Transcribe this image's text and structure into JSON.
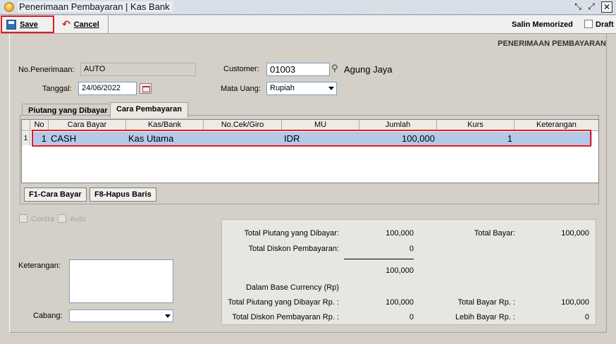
{
  "window": {
    "title": "Penerimaan Pembayaran | Kas Bank",
    "icon": "app-logo-icon"
  },
  "toolbar": {
    "save_label": "Save",
    "cancel_label": "Cancel",
    "salin_label": "Salin Memorized",
    "draft_label": "Draft"
  },
  "header": {
    "section_title": "PENERIMAAN PEMBAYARAN"
  },
  "form": {
    "no_penerimaan_label": "No.Penerimaan:",
    "no_penerimaan_value": "AUTO",
    "tanggal_label": "Tanggal:",
    "tanggal_value": "24/06/2022",
    "customer_label": "Customer:",
    "customer_code": "01003",
    "customer_name": "Agung Jaya",
    "mata_uang_label": "Mata Uang:",
    "mata_uang_value": "Rupiah"
  },
  "tabs": [
    {
      "label": "Piutang yang Dibayar",
      "active": false
    },
    {
      "label": "Cara Pembayaran",
      "active": true
    }
  ],
  "grid": {
    "columns": [
      "No",
      "Cara Bayar",
      "Kas/Bank",
      "No.Cek/Giro",
      "MU",
      "Jumlah",
      "Kurs",
      "Keterangan"
    ],
    "rows": [
      {
        "marker": "1",
        "no": "1",
        "cara_bayar": "CASH",
        "kas_bank": "Kas Utama",
        "no_cek": "",
        "mu": "IDR",
        "jumlah": "100,000",
        "kurs": "1",
        "keterangan": ""
      }
    ]
  },
  "grid_buttons": {
    "cara_bayar": "F1-Cara Bayar",
    "hapus_baris": "F8-Hapus Baris"
  },
  "options": {
    "contra_label": "Contra",
    "auto_label": "Auto"
  },
  "bottom": {
    "keterangan_label": "Keterangan:",
    "cabang_label": "Cabang:"
  },
  "summary": {
    "total_piutang_label": "Total Piutang yang Dibayar:",
    "total_piutang_value": "100,000",
    "total_diskon_label": "Total Diskon Pembayaran:",
    "total_diskon_value": "0",
    "subtotal_value": "100,000",
    "total_bayar_label": "Total Bayar:",
    "total_bayar_value": "100,000",
    "base_currency_label": "Dalam Base Currency (Rp)",
    "total_piutang_rp_label": "Total Piutang yang Dibayar Rp. :",
    "total_piutang_rp_value": "100,000",
    "total_diskon_rp_label": "Total Diskon Pembayaran Rp. :",
    "total_diskon_rp_value": "0",
    "total_bayar_rp_label": "Total Bayar Rp. :",
    "total_bayar_rp_value": "100,000",
    "lebih_bayar_rp_label": "Lebih Bayar Rp. :",
    "lebih_bayar_rp_value": "0"
  },
  "colors": {
    "highlight_red": "#e41b23",
    "row_selected": "#b4c9e8"
  }
}
